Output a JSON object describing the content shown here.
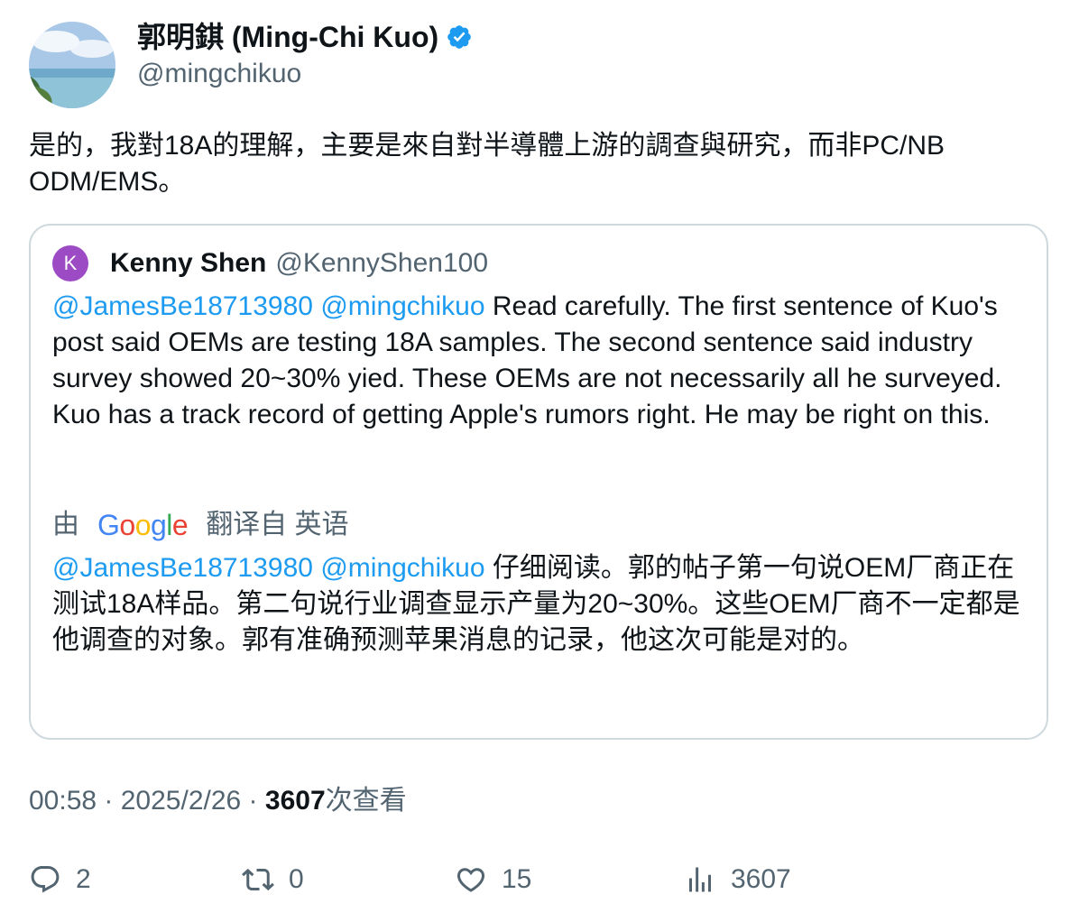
{
  "author": {
    "display_name": "郭明錤 (Ming-Chi Kuo)",
    "handle": "@mingchikuo",
    "verified_color": "#1d9bf0"
  },
  "tweet": {
    "text": "是的，我對18A的理解，主要是來自對半導體上游的調查與研究，而非PC/NB ODM/EMS。"
  },
  "quote": {
    "avatar_letter": "K",
    "avatar_color": "#9d4bc4",
    "name": "Kenny Shen",
    "handle": "@KennyShen100",
    "mention1": "@JamesBe18713980",
    "mention2": "@mingchikuo",
    "text": "Read carefully. The first sentence of Kuo's post said OEMs are testing 18A samples. The second sentence said industry survey showed 20~30% yied. These OEMs are not necessarily all he surveyed. Kuo has a track record of getting Apple's rumors right. He may be right on this.",
    "translate_prefix": "由",
    "translate_brand": "Google",
    "translate_suffix": "翻译自 英语",
    "trans_mention1": "@JamesBe18713980",
    "trans_mention2": "@mingchikuo",
    "translated_text": "仔细阅读。郭的帖子第一句说OEM厂商正在测试18A样品。第二句说行业调查显示产量为20~30%。这些OEM厂商不一定都是他调查的对象。郭有准确预测苹果消息的记录，他这次可能是对的。"
  },
  "meta": {
    "time": "00:58",
    "sep1": " · ",
    "date": "2025/2/26",
    "sep2": " · ",
    "views": "3607",
    "views_label": "次查看"
  },
  "actions": {
    "replies": "2",
    "retweets": "0",
    "likes": "15",
    "views": "3607",
    "icons": [
      "reply-icon",
      "retweet-icon",
      "like-icon",
      "views-icon"
    ]
  }
}
